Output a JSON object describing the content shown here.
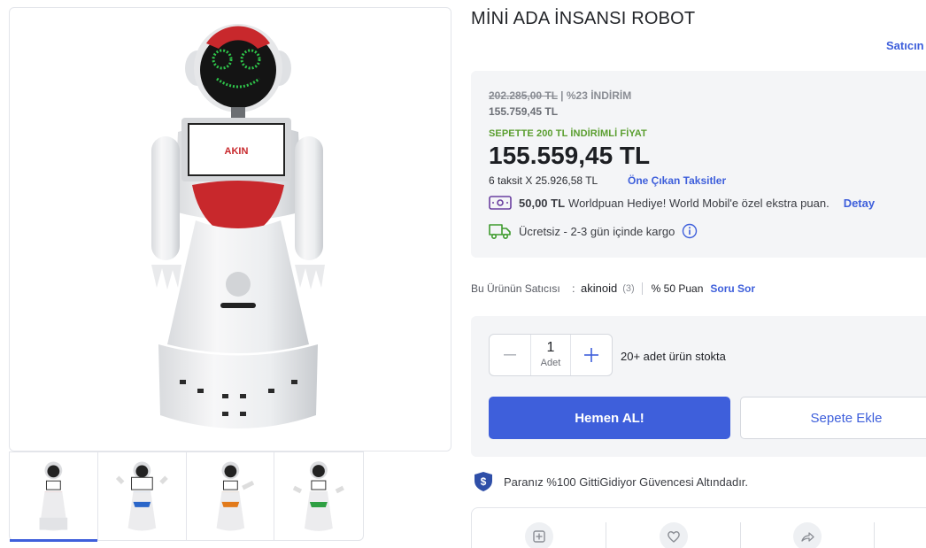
{
  "product": {
    "title": "MİNİ ADA İNSANSI ROBOT",
    "seller_link": "Satıcın"
  },
  "price": {
    "old_price": "202.285,00 TL",
    "discount": " | %23 İNDİRİM",
    "discounted_price": "155.759,45 TL",
    "cart_discount_label": "SEPETTE 200 TL İNDİRİMLİ FİYAT",
    "final_price": "155.559,45 TL",
    "installment": "6 taksit X 25.926,58 TL",
    "installment_link": "Öne Çıkan Taksitler",
    "points_amount": "50,00 TL",
    "points_text": "Worldpuan Hediye! World Mobil'e özel ekstra puan.",
    "points_detail": "Detay",
    "cargo_text": "Ücretsiz - 2-3 gün içinde kargo"
  },
  "seller": {
    "label": "Bu Ürünün Satıcısı",
    "colon": ":",
    "name": "akinoid",
    "count": "(3)",
    "score": "% 50 Puan",
    "ask": "Soru Sor"
  },
  "purchase": {
    "quantity": "1",
    "unit": "Adet",
    "stock": "20+ adet ürün stokta",
    "buy_now": "Hemen AL!",
    "add_to_cart": "Sepete Ekle"
  },
  "guarantee": {
    "text": "Paranız %100 GittiGidiyor Güvencesi Altındadır."
  },
  "colors": {
    "accent": "#3e5fdb",
    "green": "#5a9e2f",
    "thumb_accents": [
      "#d8232a",
      "#2a66c9",
      "#e27a1a",
      "#2fa043"
    ]
  },
  "icons": {
    "points": "money-icon",
    "cargo": "truck-icon",
    "info": "info-icon",
    "guarantee": "shield-icon",
    "actions": [
      "add-to-list-icon",
      "heart-icon",
      "share-icon"
    ]
  }
}
